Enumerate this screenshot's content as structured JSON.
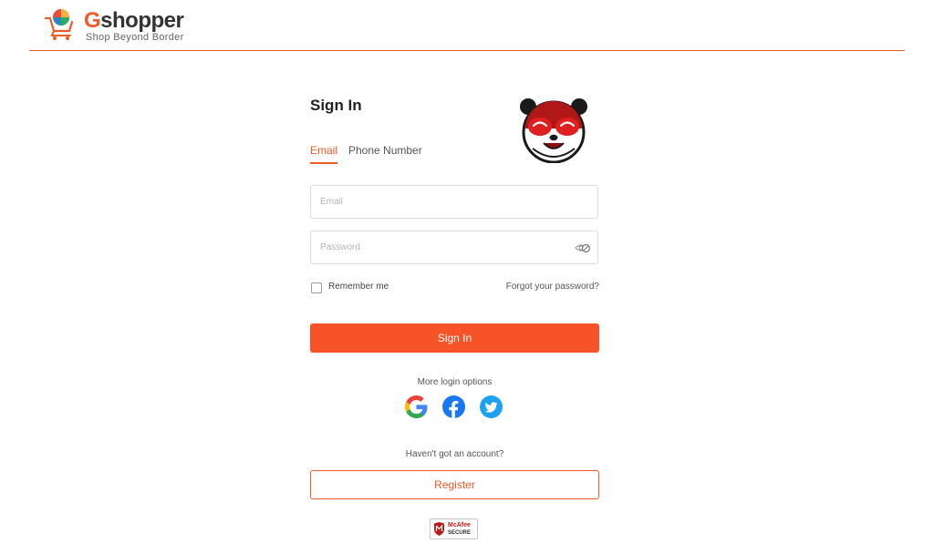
{
  "header": {
    "logo": {
      "brand_prefix": "G",
      "brand_rest": "shopper",
      "tagline": "Shop Beyond Border"
    }
  },
  "signin": {
    "title": "Sign In",
    "tabs": [
      {
        "label": "Email",
        "active": true
      },
      {
        "label": "Phone Number",
        "active": false
      }
    ],
    "email": {
      "placeholder": "Email",
      "value": ""
    },
    "password": {
      "placeholder": "Password",
      "value": ""
    },
    "remember_label": "Remember me",
    "remember_checked": false,
    "forgot_label": "Forgot your password?",
    "submit_label": "Sign In",
    "more_options_label": "More login options",
    "social": [
      {
        "icon": "google-icon",
        "color": "#4285F4"
      },
      {
        "icon": "facebook-icon",
        "color": "#1877F2"
      },
      {
        "icon": "twitter-icon",
        "color": "#1DA1F2"
      }
    ],
    "no_account_label": "Haven't got an account?",
    "register_label": "Register"
  },
  "badge": {
    "brand": "McAfee",
    "text": "SECURE"
  },
  "colors": {
    "accent": "#F05A28",
    "primary_button": "#F75328"
  }
}
